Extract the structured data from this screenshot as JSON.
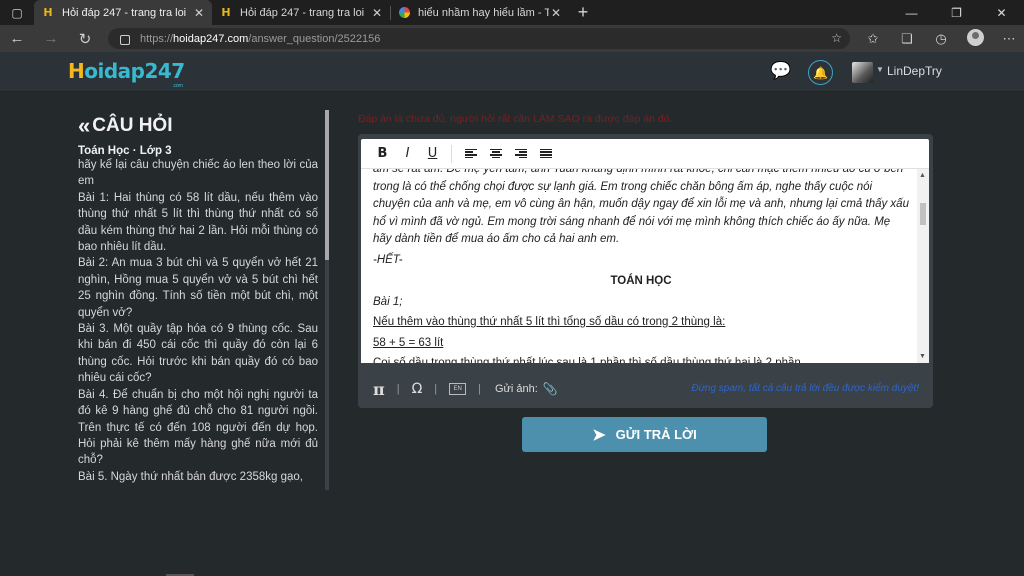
{
  "browser": {
    "tabs": [
      {
        "title": "Hỏi đáp 247 - trang tra loi",
        "favicon": "H",
        "active": true
      },
      {
        "title": "Hỏi đáp 247 - trang tra loi",
        "favicon": "H",
        "active": false
      },
      {
        "title": "hiểu nhầm hay hiểu lầm - Tìm trê",
        "favicon": "google-icon",
        "active": false
      }
    ],
    "url_scheme": "https://",
    "url_host": "hoidap247.com",
    "url_path": "/answer_question/2522156"
  },
  "site": {
    "logo_first": "H",
    "logo_rest": "oidap247",
    "logo_sub": ".com",
    "username": "LinDepTry"
  },
  "question": {
    "heading": "CÂU HỎI",
    "subject": "Toán Học · Lớp 3",
    "body": "hãy kể lại câu chuyện chiếc áo len theo lời của em\nBài 1: Hai thùng có 58 lít dầu, nếu thêm vào thùng thứ nhất 5 lít thì thùng thứ nhất có số dầu kém thùng thứ hai 2 lần. Hỏi mỗi thùng có bao nhiêu lít dầu.\nBài 2: An mua 3 bút chì và 5 quyển vở hết 21 nghìn, Hồng mua 5 quyển vở và 5 bút chì hết 25 nghìn đồng. Tính số tiền một bút chì, một quyển vở?\nBài 3. Một quầy tập hóa có 9 thùng cốc. Sau khi bán đi 450 cái cốc thì quầy đó còn lại 6 thùng cốc. Hỏi trước khi bán quầy đó có bao nhiêu cái cốc?\nBài 4. Để chuẩn bị cho một hội nghị người ta đó kê 9 hàng ghế đủ chỗ cho 81 người ngồi. Trên thực tế có đến 108 người đến dự họp. Hỏi phải kê thêm mấy hàng ghế nữa mới đủ chỗ?\nBài 5. Ngày thứ nhất bán được 2358kg gạo,"
  },
  "answer": {
    "warning": "Đáp án là chưa đủ, người hỏi rất cần LÀM SAO ra được đáp án đó.",
    "content": {
      "p1": "ấm sẽ rất ấm. Để mẹ yên tâm, anh Tuấn khẳng định mình rất khỏe, chỉ cần mặc thêm nhiều áo cũ ở bên trong là có thể chống chọi được sự lạnh giá. Em trong chiếc chăn bông ấm áp, nghe thấy cuộc nói chuyện của anh và mẹ, em vô cùng ân hận, muốn dậy ngay để xin lỗi mẹ và anh, nhưng lại cmả thấy xấu hổ vì mình đã vờ ngủ. Em mong trời sáng nhanh để nói với mẹ mình không thích chiếc áo ấy nữa. Mẹ hãy dành tiền để mua áo ấm cho cả hai anh em.",
      "end": "-HẾT-",
      "section": "TOÁN HỌC",
      "bai1": "Bài 1;",
      "line1": "Nếu thêm vào thùng thứ nhất 5 lít thì tổng số dầu có trong 2 thùng là:",
      "line2": "58 + 5 = 63 lít",
      "line3": "Coi số dầu trong thùng thứ nhất lúc sau là 1 phần thì số dầu thùng thứ hai là 2 phần"
    },
    "footer_image_label": "Gửi ảnh:",
    "footer_kbd": "EN",
    "footer_note": "Đừng spam, tất cả câu trả lời đều được kiểm duyệt!",
    "submit_label": "GỬI TRẢ LỜI"
  },
  "colors": {
    "accent": "#4d90ad",
    "logo_yellow": "#f4b81c",
    "logo_teal": "#39b9cf",
    "warning": "#7a1f1f",
    "note_blue": "#2f65c9"
  }
}
